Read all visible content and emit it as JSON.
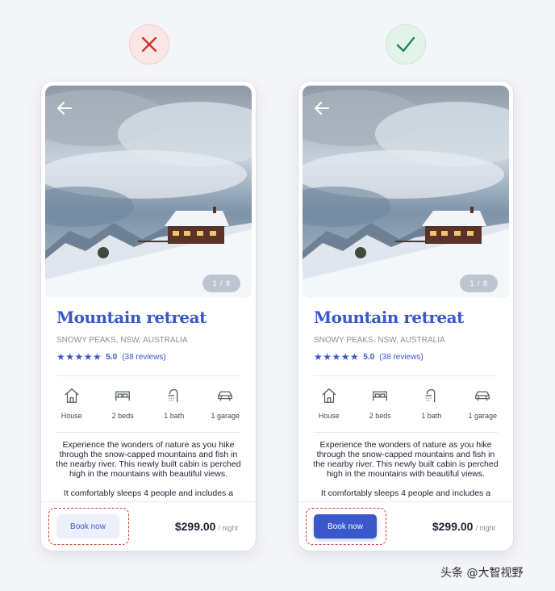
{
  "comparison": {
    "bad": {
      "icon": "close-icon",
      "color": "#d0312d"
    },
    "good": {
      "icon": "check-icon",
      "color": "#1e8a55"
    }
  },
  "listing": {
    "photo_counter": "1 / 8",
    "title": "Mountain retreat",
    "location": "SNOWY PEAKS, NSW, AUSTRALIA",
    "stars": "★★★★★",
    "rating": "5.0",
    "reviews": "(38 reviews)",
    "amenities": [
      {
        "icon": "house-icon",
        "label": "House"
      },
      {
        "icon": "bed-icon",
        "label": "2 beds"
      },
      {
        "icon": "shower-icon",
        "label": "1 bath"
      },
      {
        "icon": "car-icon",
        "label": "1 garage"
      }
    ],
    "description": [
      "Experience the wonders of nature as you hike through the snow-capped mountains and fish in the nearby river. This newly built cabin is perched high in the mountains with beautiful views.",
      "It comfortably sleeps 4 people and includes a"
    ],
    "book_label": "Book now",
    "price": "$299.00",
    "price_unit": "/ night"
  },
  "colors": {
    "accent": "#3a58c9",
    "highlight": "#cc3b3b",
    "light_button": "#edf0fb"
  },
  "watermark": "头条 @大智视野"
}
